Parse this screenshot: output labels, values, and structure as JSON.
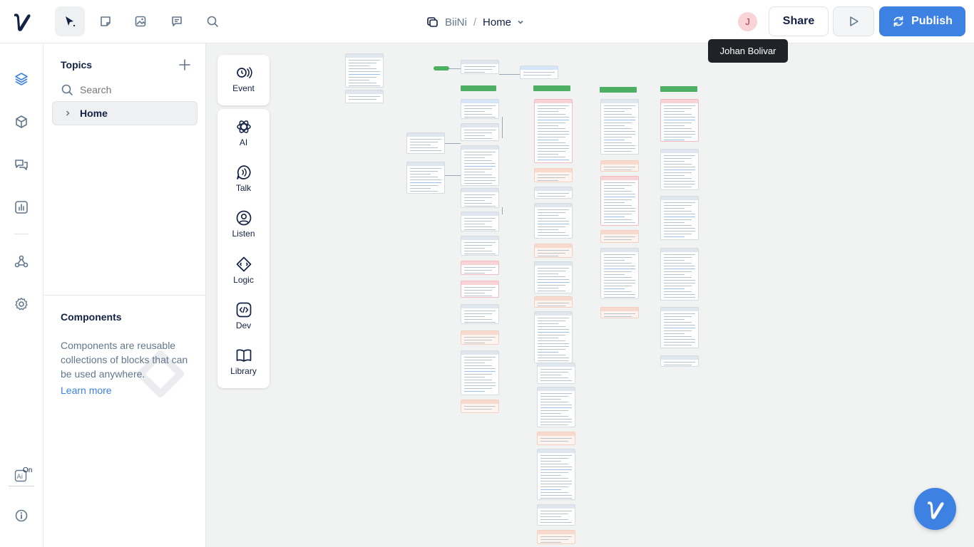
{
  "header": {
    "project_name": "BiiNi",
    "separator": "/",
    "page_name": "Home",
    "avatar_initial": "J",
    "share_label": "Share",
    "publish_label": "Publish",
    "tooltip_text": "Johan Bolivar",
    "accent_color": "#3d82e2",
    "tools": [
      {
        "name": "select-tool",
        "icon": "cursor-icon",
        "active": true
      },
      {
        "name": "sticky-note-tool",
        "icon": "note-icon",
        "active": false
      },
      {
        "name": "image-tool",
        "icon": "image-icon",
        "active": false
      },
      {
        "name": "comment-tool",
        "icon": "comment-icon",
        "active": false
      },
      {
        "name": "search-tool",
        "icon": "search-icon",
        "active": false
      }
    ]
  },
  "rail": {
    "items": [
      {
        "icon": "layers-icon",
        "active": true
      },
      {
        "icon": "cube-icon",
        "active": false
      },
      {
        "icon": "conversations-icon",
        "active": false
      },
      {
        "icon": "analytics-icon",
        "active": false
      },
      {
        "icon": "integrations-icon",
        "active": false
      },
      {
        "icon": "settings-icon",
        "active": false
      },
      {
        "icon": "ai-icon",
        "active": false
      },
      {
        "icon": "info-icon",
        "active": false
      }
    ],
    "ai_toggle_label": "On"
  },
  "topics": {
    "title": "Topics",
    "search_placeholder": "Search",
    "items": [
      {
        "label": "Home",
        "selected": true
      }
    ]
  },
  "components": {
    "title": "Components",
    "description": "Components are reusable collections of blocks that can be used anywhere.",
    "link_label": "Learn more"
  },
  "palette": {
    "event_label": "Event",
    "items": [
      {
        "label": "AI",
        "icon": "openai-icon"
      },
      {
        "label": "Talk",
        "icon": "talk-icon"
      },
      {
        "label": "Listen",
        "icon": "listen-icon"
      },
      {
        "label": "Logic",
        "icon": "logic-icon"
      },
      {
        "label": "Dev",
        "icon": "code-icon"
      },
      {
        "label": "Library",
        "icon": "book-icon"
      }
    ]
  }
}
